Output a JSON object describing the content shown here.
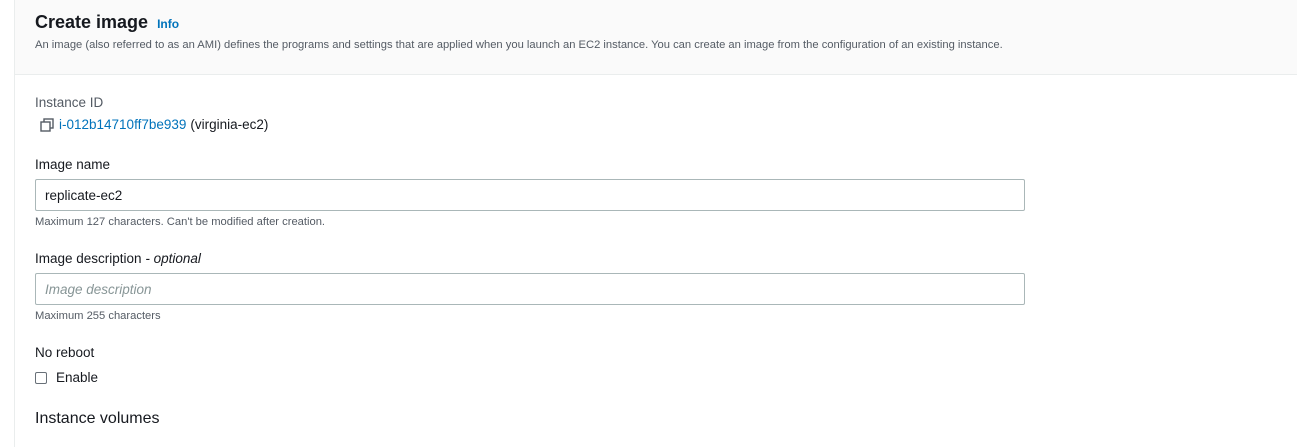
{
  "header": {
    "title": "Create image",
    "info_label": "Info",
    "description": "An image (also referred to as an AMI) defines the programs and settings that are applied when you launch an EC2 instance. You can create an image from the configuration of an existing instance."
  },
  "instance": {
    "label": "Instance ID",
    "id": "i-012b14710ff7be939",
    "name": "(virginia-ec2)"
  },
  "image_name": {
    "label": "Image name",
    "value": "replicate-ec2",
    "hint": "Maximum 127 characters. Can't be modified after creation."
  },
  "image_description": {
    "label": "Image description",
    "optional": "- optional",
    "value": "",
    "placeholder": "Image description",
    "hint": "Maximum 255 characters"
  },
  "no_reboot": {
    "label": "No reboot",
    "checkbox_label": "Enable",
    "checked": false
  },
  "volumes": {
    "title": "Instance volumes"
  },
  "colors": {
    "link": "#0073bb",
    "text": "#16191f",
    "muted": "#545b64",
    "border": "#aab7b8",
    "header_bg": "#fafafa"
  }
}
